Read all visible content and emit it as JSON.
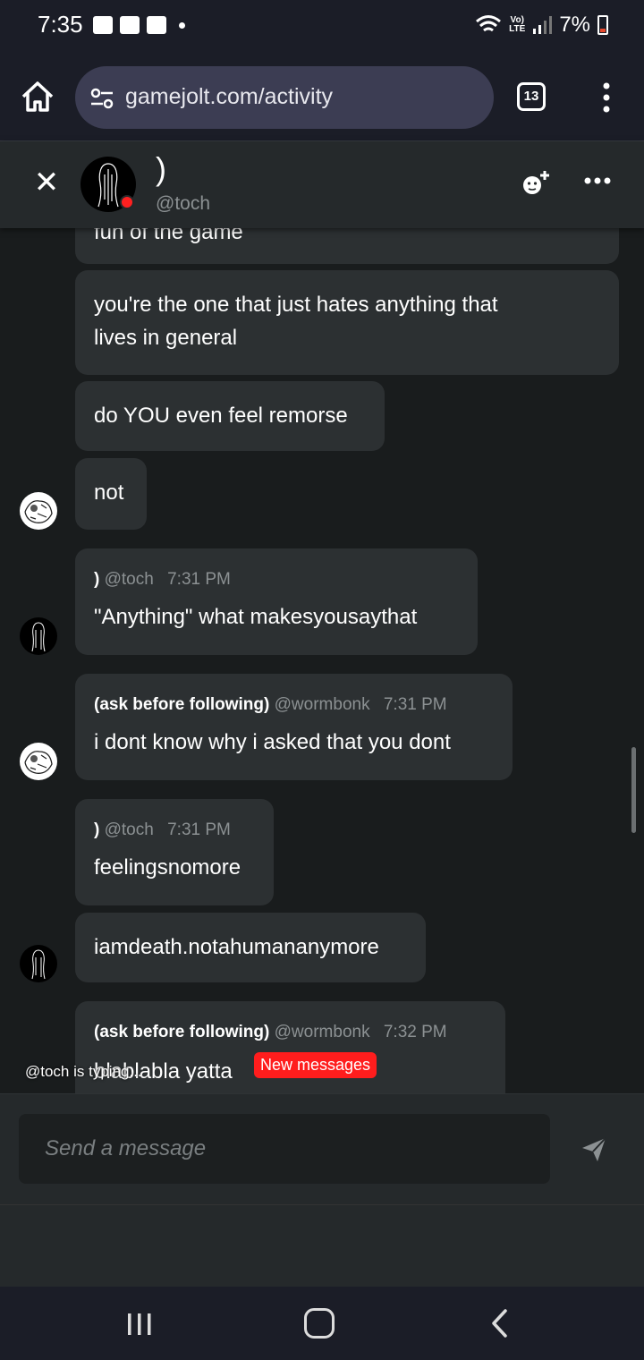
{
  "status_bar": {
    "time": "7:35",
    "battery": "7%",
    "network": "LTE"
  },
  "browser": {
    "url": "gamejolt.com/activity",
    "tab_count": "13"
  },
  "chat_header": {
    "name": ")",
    "handle": "@toch"
  },
  "messages": [
    {
      "text": "fun of the game"
    },
    {
      "text": "you're the one that just hates anything that lives in general",
      "line1": "you're the one that just hates anything that",
      "line2": "lives in general"
    },
    {
      "text": "do YOU even feel remorse"
    },
    {
      "text": "not"
    },
    {
      "name": ")",
      "handle": "@toch",
      "time": "7:31 PM",
      "text": "\"Anything\" what makesyousaythat"
    },
    {
      "name": "(ask before following)",
      "handle": "@wormbonk",
      "time": "7:31 PM",
      "text": "i dont know why i asked that you dont"
    },
    {
      "name": ")",
      "handle": "@toch",
      "time": "7:31 PM",
      "text": "feelingsnomore"
    },
    {
      "text": "iamdeath.notahumananymore"
    },
    {
      "name": "(ask before following)",
      "handle": "@wormbonk",
      "time": "7:32 PM",
      "text": "blablabla yatta"
    }
  ],
  "typing_indicator": "@toch is typing...",
  "new_messages_label": "New messages",
  "composer": {
    "placeholder": "Send a message"
  },
  "colors": {
    "bubble": "#2c3032",
    "background": "#191c1d",
    "online_status": "#ff2020",
    "new_messages": "#ff1d1d"
  },
  "icons": [
    "home-icon",
    "site-settings-icon",
    "tab-switcher-icon",
    "overflow-menu-icon",
    "close-icon",
    "add-friend-icon",
    "more-options-icon",
    "send-icon",
    "recent-apps-icon",
    "nav-home-icon",
    "nav-back-icon"
  ]
}
